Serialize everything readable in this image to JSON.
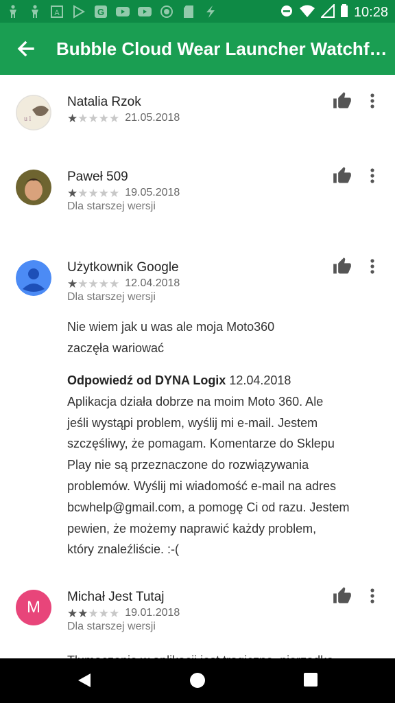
{
  "status_bar": {
    "time": "10:28"
  },
  "app_bar": {
    "title": "Bubble Cloud Wear Launcher Watchfa…"
  },
  "reviews": [
    {
      "name": "Natalia Rzok",
      "date": "21.05.2018",
      "rating": 1,
      "note": ""
    },
    {
      "name": "Paweł 509",
      "date": "19.05.2018",
      "rating": 1,
      "note": "Dla starszej wersji"
    },
    {
      "name": "Użytkownik Google",
      "date": "12.04.2018",
      "rating": 1,
      "note": "Dla starszej wersji",
      "text": [
        "Nie wiem jak u was ale moja Moto360",
        "zaczęła wariować"
      ],
      "reply_from": "Odpowiedź od DYNA Logix",
      "reply_date": "12.04.2018",
      "reply_lines": [
        "Aplikacja działa dobrze na moim Moto 360. Ale",
        "jeśli wystąpi problem, wyślij mi e-mail. Jestem",
        "szczęśliwy, że pomagam. Komentarze do Sklepu",
        "Play nie są przeznaczone do rozwiązywania",
        "problemów. Wyślij mi wiadomość e-mail na adres",
        "bcwhelp@gmail.com, a pomogę Ci od razu. Jestem",
        "pewien, że możemy naprawić każdy problem,",
        "który znaleźliście. :-("
      ]
    },
    {
      "name": "Michał Jest Tutaj",
      "date": "19.01.2018",
      "rating": 2,
      "note": "Dla starszej wersji",
      "avatar_letter": "M",
      "text": [
        "Tłumaczenie w aplikacji jest tragiczne, nierzadko"
      ]
    }
  ],
  "colors": {
    "status_bar": "#0e8a45",
    "app_bar": "#1a9e52",
    "avatar_m": "#e8457a",
    "avatar_google": "#4c8bf5"
  }
}
